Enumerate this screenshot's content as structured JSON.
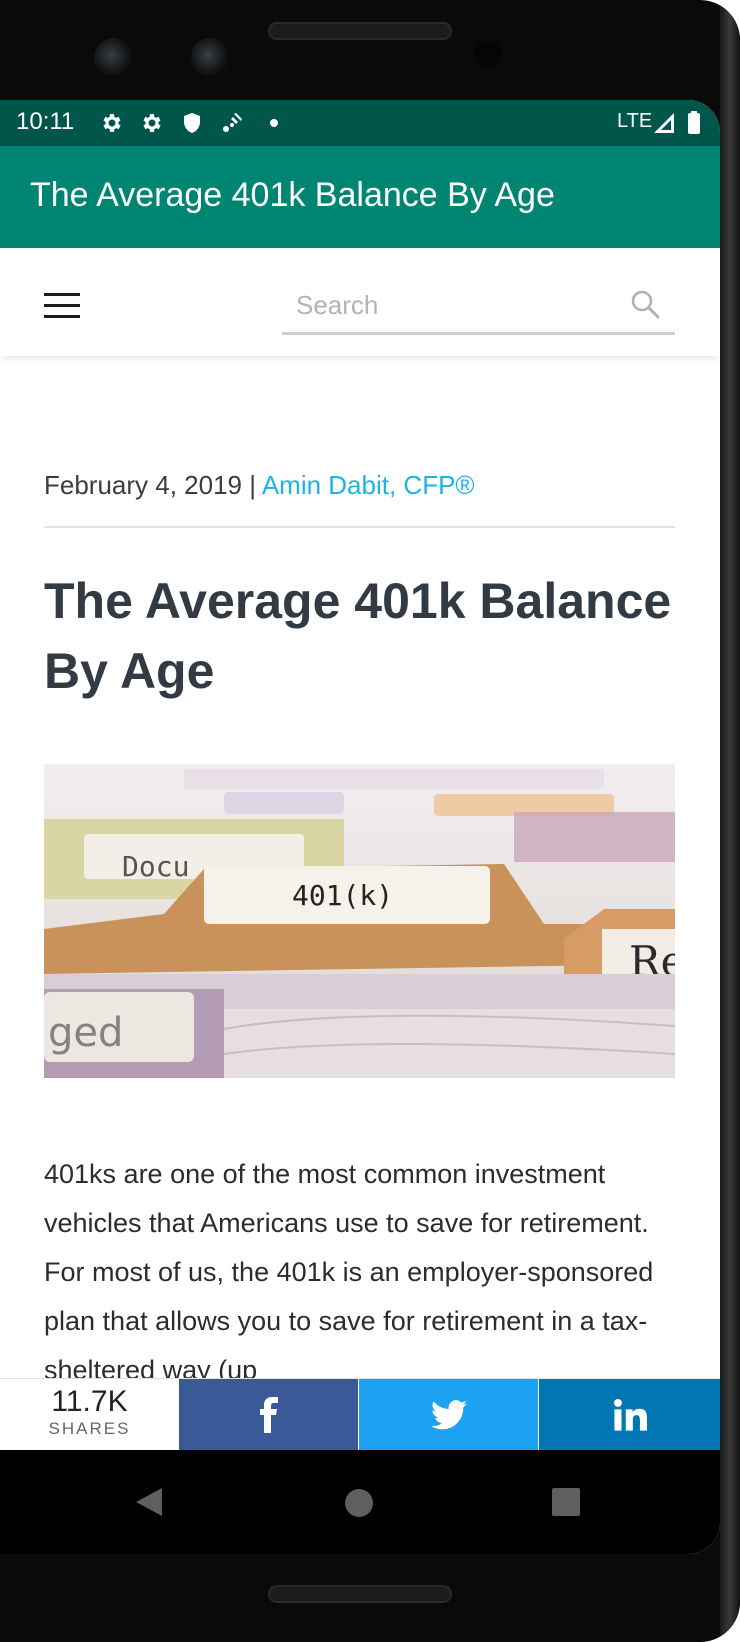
{
  "status_bar": {
    "time": "10:11",
    "network": "LTE",
    "icons": [
      "gear-icon",
      "gear-icon",
      "shield-icon",
      "cast-icon",
      "dot-icon",
      "signal-icon",
      "battery-icon"
    ]
  },
  "app_bar": {
    "title": "The Average 401k Balance By Age"
  },
  "site_header": {
    "menu_icon": "hamburger-icon",
    "search_placeholder": "Search",
    "search_icon": "search-icon"
  },
  "article": {
    "date": "February 4, 2019",
    "separator": "|",
    "author": "Amin Dabit, CFP®",
    "title": "The Average 401k Balance By Age",
    "hero": {
      "tab_labels": [
        "Docu",
        "401(k)",
        "Re",
        "ged"
      ]
    },
    "intro": "401ks are one of the most common investment vehicles that Americans use to save for retirement. For most of us, the 401k is an employer-sponsored plan that allows you to save for retirement in a tax-sheltered way (up"
  },
  "share_bar": {
    "count": "11.7K",
    "count_label": "SHARES",
    "buttons": [
      {
        "network": "facebook",
        "icon": "facebook-icon",
        "color": "#3b5998"
      },
      {
        "network": "twitter",
        "icon": "twitter-icon",
        "color": "#1da1f2"
      },
      {
        "network": "linkedin",
        "icon": "linkedin-icon",
        "color": "#0077b5"
      }
    ]
  },
  "nav_bar": {
    "buttons": [
      "back-icon",
      "home-icon",
      "recents-icon"
    ]
  },
  "colors": {
    "status_bar": "#00564a",
    "app_bar": "#018573",
    "author_link": "#19b5e6",
    "title_text": "#323b44"
  }
}
